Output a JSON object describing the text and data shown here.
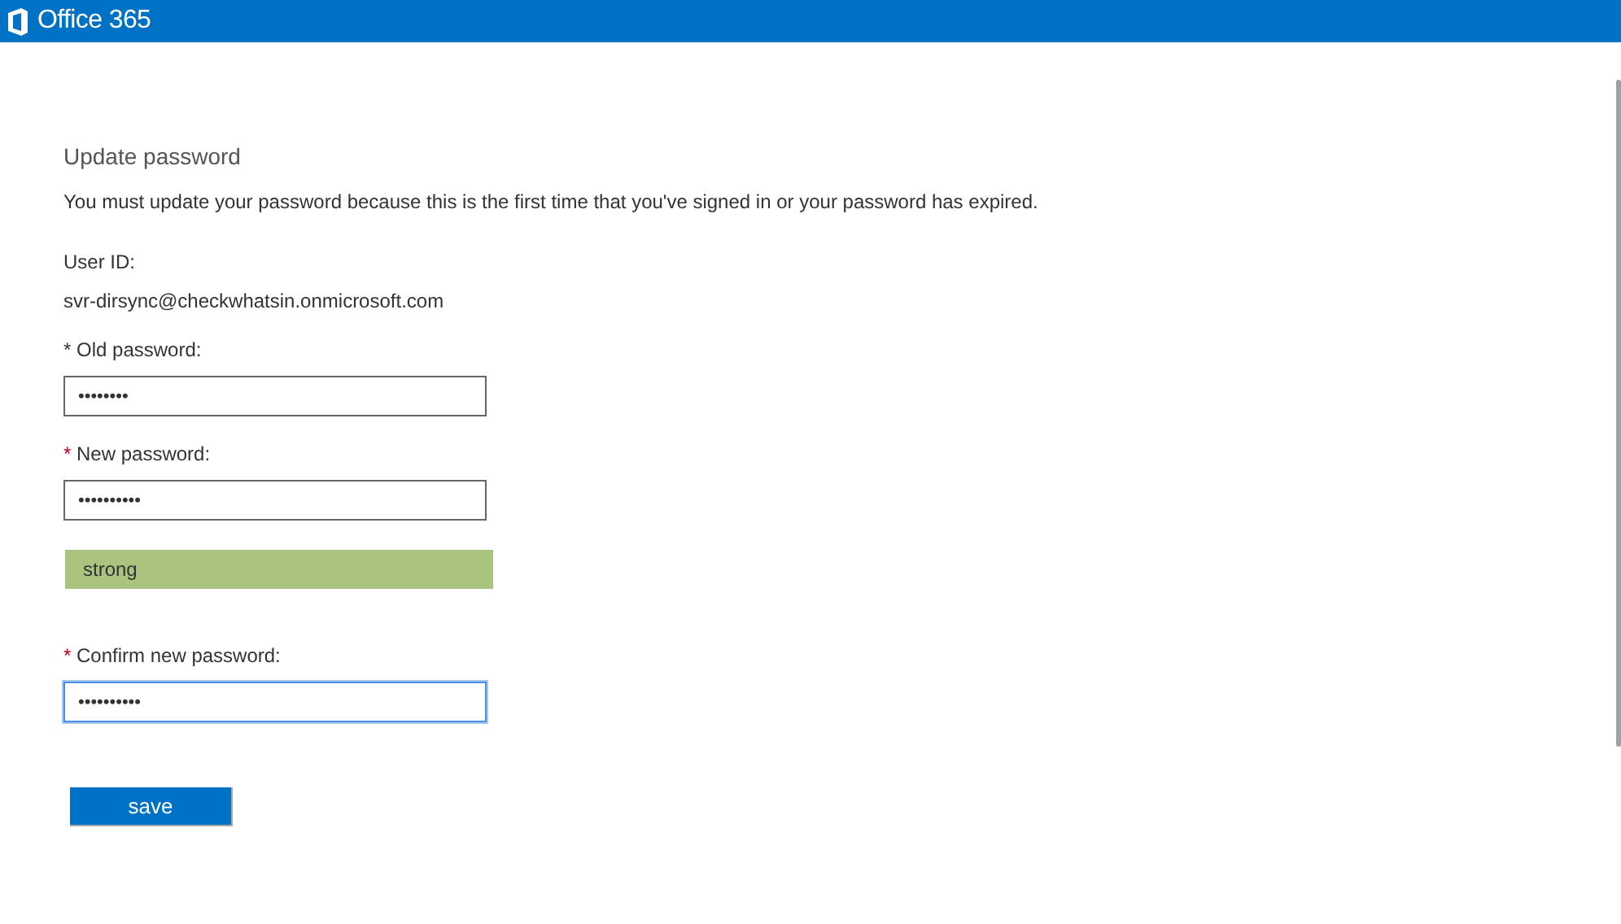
{
  "header": {
    "product": "Office 365"
  },
  "form": {
    "title": "Update password",
    "message": "You must update your password because this is the first time that you've signed in or your password has expired.",
    "user_id_label": "User ID:",
    "user_id": "svr-dirsync@checkwhatsin.onmicrosoft.com",
    "fields": [
      {
        "kind": "field",
        "marker": "*",
        "marker_emphasized": false,
        "label": "Old password:",
        "value": "••••••••",
        "focused": false
      },
      {
        "kind": "field",
        "marker": "*",
        "marker_emphasized": true,
        "label": "New password:",
        "value": "••••••••••",
        "focused": false
      },
      {
        "kind": "meter",
        "label": "strong",
        "level": 1
      },
      {
        "kind": "field",
        "marker": "*",
        "marker_emphasized": true,
        "label": "Confirm new password:",
        "value": "••••••••••",
        "focused": true
      }
    ],
    "save_button": "save"
  }
}
